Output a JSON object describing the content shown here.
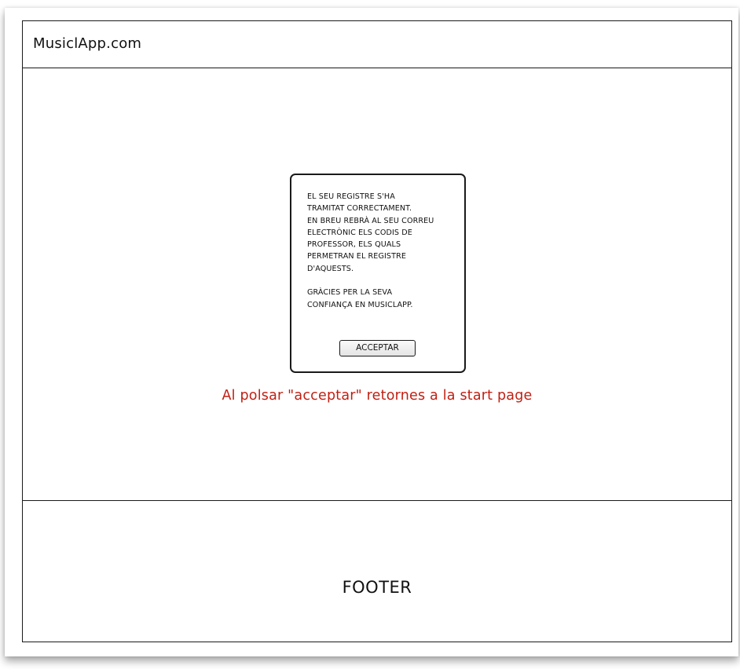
{
  "header": {
    "site_title": "MusiclApp.com"
  },
  "dialog": {
    "message": "EL SEU REGISTRE S'HA\nTRAMITAT CORRECTAMENT.\nEN BREU REBRÀ AL SEU CORREU\nELECTRÒNIC ELS CODIS DE\nPROFESSOR, ELS QUALS\nPERMETRAN EL REGISTRE\nD'AQUESTS.\n\nGRÀCIES PER LA SEVA\nCONFIANÇA EN MUSICLAPP.",
    "accept_label": "ACCEPTAR"
  },
  "annotation": {
    "text": "Al polsar \"acceptar\" retornes a la start page",
    "color": "#c01f12"
  },
  "footer": {
    "label": "FOOTER"
  }
}
